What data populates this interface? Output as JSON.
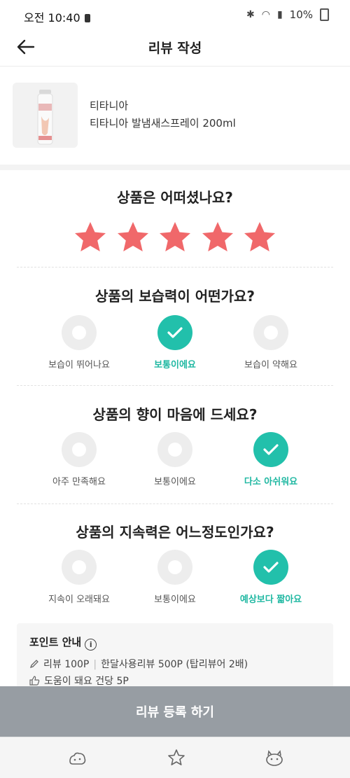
{
  "status_bar": {
    "time": "오전 10:40",
    "battery": "10%"
  },
  "header": {
    "title": "리뷰 작성"
  },
  "product": {
    "brand": "티타니아",
    "name": "티타니아 발냄새스프레이 200ml"
  },
  "rating": {
    "question": "상품은 어떠셨나요?",
    "value": 5,
    "max": 5,
    "color": "#f0686a"
  },
  "questions": [
    {
      "question": "상품의 보습력이 어떤가요?",
      "options": [
        "보습이 뛰어나요",
        "보통이에요",
        "보습이 약해요"
      ],
      "selected": 1
    },
    {
      "question": "상품의 향이 마음에 드세요?",
      "options": [
        "아주 만족해요",
        "보통이에요",
        "다소 아쉬워요"
      ],
      "selected": 2
    },
    {
      "question": "상품의 지속력은 어느정도인가요?",
      "options": [
        "지속이 오래돼요",
        "보통이에요",
        "예상보다 짧아요"
      ],
      "selected": 2
    }
  ],
  "points": {
    "title": "포인트 안내",
    "review": "리뷰 100P",
    "month_review": "한달사용리뷰 500P (탑리뷰어 2배)",
    "helpful": "도움이 돼요 건당 5P"
  },
  "submit_label": "리뷰 등록 하기",
  "accent_color": "#22c0ab"
}
